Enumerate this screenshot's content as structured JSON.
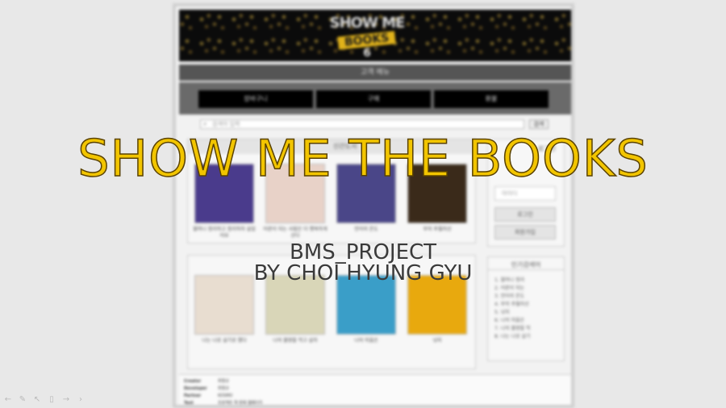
{
  "site": {
    "banner": {
      "logo_line1": "SHOW ME",
      "logo_line2": "BOOKS",
      "logo_line3": "6"
    },
    "menu_title": "고객 메뉴",
    "nav": [
      "장바구니",
      "구매",
      "환불"
    ],
    "search": {
      "placeholder": "검색어 입력",
      "button": "검색"
    },
    "section1_title": "신간도서",
    "books_row1": [
      {
        "title": "할머니 정리하고 정리하자 살았어요",
        "color": "#4a3b8c"
      },
      {
        "title": "어른이 되는 사람은 더 행복하게 산다",
        "color": "#e8d2c8"
      },
      {
        "title": "언어의 온도",
        "color": "#4a4688"
      },
      {
        "title": "부의 추월차선",
        "color": "#3a2a1a"
      }
    ],
    "books_row2": [
      {
        "title": "나는 나로 살기로 했다",
        "color": "#e8ddd0"
      },
      {
        "title": "나의 불량을 먹고 살자",
        "color": "#d9d6b8"
      },
      {
        "title": "나의 미움은",
        "color": "#3a9ec8"
      },
      {
        "title": "넛지",
        "color": "#e8a90e"
      }
    ],
    "login": {
      "header": "로그인",
      "id_placeholder": "아이디",
      "login_btn": "로그인",
      "signup_btn": "회원가입"
    },
    "ranking": {
      "header": "인기검색어",
      "items": [
        "1. 할머니 정리",
        "2. 어른이 되는",
        "3. 언어의 온도",
        "4. 부의 추월차선",
        "5. 넛지",
        "6. 나의 미움은",
        "7. 나의 불량을 먹",
        "8. 나는 나로 살기"
      ]
    },
    "footer": [
      {
        "key": "Creator",
        "value": "최형규"
      },
      {
        "key": "Developer",
        "value": "최형규"
      },
      {
        "key": "Partner",
        "value": "KOSMO"
      },
      {
        "key": "Text",
        "value": "프로젝트 책 판매 웹페이지"
      }
    ]
  },
  "overlay": {
    "title": "SHOW ME THE BOOKS",
    "subtitle_line1": "BMS_PROJECT",
    "subtitle_line2": "BY CHOI HYUNG GYU"
  },
  "toolbar_icons": [
    "arrow-left-icon",
    "pen-icon",
    "pointer-icon",
    "slides-icon",
    "arrow-right-icon",
    "more-icon"
  ],
  "toolbar_glyphs": [
    "←",
    "✎",
    "↖",
    "▯",
    "→",
    "›"
  ],
  "colors": {
    "title_fill": "#f2c500",
    "subtitle": "#3a3a3a",
    "background": "#e8e8e8"
  }
}
